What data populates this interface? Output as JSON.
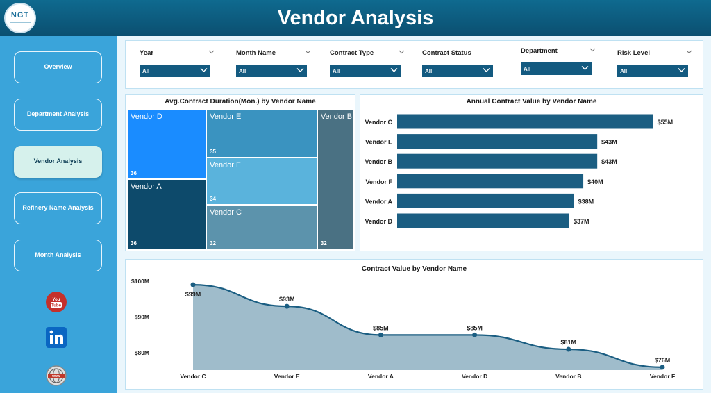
{
  "header": {
    "title": "Vendor Analysis",
    "logo_text": "NGT"
  },
  "sidebar": {
    "items": [
      {
        "label": "Overview",
        "active": false
      },
      {
        "label": "Department Analysis",
        "active": false
      },
      {
        "label": "Vendor Analysis",
        "active": true
      },
      {
        "label": "Refinery Name Analysis",
        "active": false
      },
      {
        "label": "Month Analysis",
        "active": false
      }
    ],
    "social": [
      {
        "icon": "youtube-icon",
        "label": "You Tube"
      },
      {
        "icon": "linkedin-icon",
        "label": "in"
      },
      {
        "icon": "globe-www-icon",
        "label": "www"
      }
    ]
  },
  "filters": [
    {
      "label": "Year",
      "value": "All"
    },
    {
      "label": "Month Name",
      "value": "All"
    },
    {
      "label": "Contract Type",
      "value": "All"
    },
    {
      "label": "Contract Status",
      "value": "All"
    },
    {
      "label": "Department",
      "value": "All"
    },
    {
      "label": "Risk Level",
      "value": "All"
    }
  ],
  "colors": {
    "header": "#0b5f85",
    "sidebar": "#3aa4da",
    "bar": "#1b5e82",
    "line": "#1b5e82",
    "area": "#9fbccb"
  },
  "chart_data": [
    {
      "type": "treemap",
      "title": "Avg.Contract Duration(Mon.) by Vendor Name",
      "items": [
        {
          "name": "Vendor D",
          "value": 36,
          "color": "#1a8cff"
        },
        {
          "name": "Vendor A",
          "value": 36,
          "color": "#0d4a6b"
        },
        {
          "name": "Vendor E",
          "value": 35,
          "color": "#3a93c0"
        },
        {
          "name": "Vendor F",
          "value": 34,
          "color": "#5ab3dc"
        },
        {
          "name": "Vendor C",
          "value": 32,
          "color": "#5c93ac"
        },
        {
          "name": "Vendor B",
          "value": 32,
          "color": "#4a7183"
        }
      ]
    },
    {
      "type": "bar",
      "orientation": "horizontal",
      "title": "Annual Contract Value by Vendor Name",
      "categories": [
        "Vendor C",
        "Vendor E",
        "Vendor B",
        "Vendor F",
        "Vendor A",
        "Vendor D"
      ],
      "values": [
        55,
        43,
        43,
        40,
        38,
        37
      ],
      "value_labels": [
        "$55M",
        "$43M",
        "$43M",
        "$40M",
        "$38M",
        "$37M"
      ],
      "xlim": [
        0,
        57
      ]
    },
    {
      "type": "area",
      "title": "Contract Value by Vendor Name",
      "categories": [
        "Vendor C",
        "Vendor E",
        "Vendor A",
        "Vendor D",
        "Vendor B",
        "Vendor F"
      ],
      "values": [
        99,
        93,
        85,
        85,
        81,
        76
      ],
      "value_labels": [
        "$99M",
        "$93M",
        "$85M",
        "$85M",
        "$81M",
        "$76M"
      ],
      "yticks": [
        {
          "value": 100,
          "label": "$100M"
        },
        {
          "value": 90,
          "label": "$90M"
        },
        {
          "value": 80,
          "label": "$80M"
        }
      ],
      "ylim": [
        75,
        100
      ]
    }
  ]
}
